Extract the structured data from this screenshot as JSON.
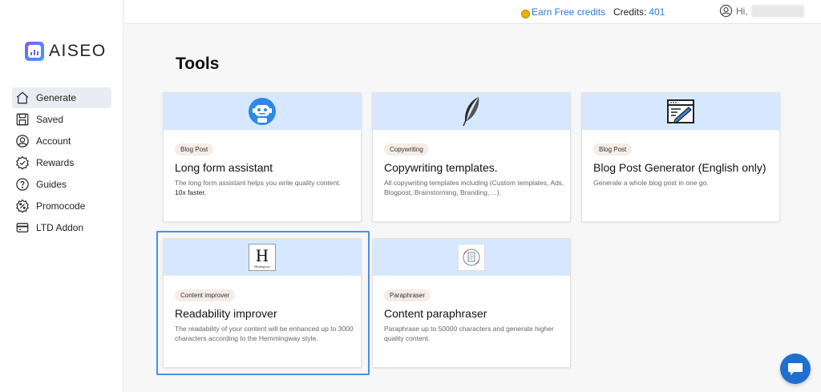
{
  "brand": {
    "name": "AISEO"
  },
  "sidebar": {
    "items": [
      {
        "label": "Generate",
        "icon": "home-icon",
        "active": true
      },
      {
        "label": "Saved",
        "icon": "save-icon"
      },
      {
        "label": "Account",
        "icon": "user-icon"
      },
      {
        "label": "Rewards",
        "icon": "badge-check-icon"
      },
      {
        "label": "Guides",
        "icon": "question-icon"
      },
      {
        "label": "Promocode",
        "icon": "discount-icon"
      },
      {
        "label": "LTD Addon",
        "icon": "card-icon"
      }
    ]
  },
  "topbar": {
    "earn_label": "Earn Free credits",
    "credits_label": "Credits:",
    "credits_value": "401",
    "greeting": "Hi,"
  },
  "main": {
    "title": "Tools",
    "cards": [
      {
        "tag": "Blog Post",
        "title": "Long form assistant",
        "desc": "The long form assistant helps you write quality content.",
        "desc_extra": "10x faster.",
        "icon": "robot-icon"
      },
      {
        "tag": "Copywriting",
        "title": "Copywriting templates.",
        "desc": "All copywriting templates including (Custom templates, Ads, Blogpost, Brainstorming, Branding, ...).",
        "icon": "feather-icon"
      },
      {
        "tag": "Blog Post",
        "title": "Blog Post Generator (English only)",
        "desc": "Generate a whole blog post in one go.",
        "icon": "edit-window-icon"
      },
      {
        "tag": "Content improver",
        "title": "Readability improver",
        "desc": "The readability of your content will be enhanced up to 3000 characters according to the Hemmingway style.",
        "icon": "hemingway-icon",
        "icon_text": "H",
        "icon_subtext": "Hemingway"
      },
      {
        "tag": "Paraphraser",
        "title": "Content paraphraser",
        "desc": "Paraphrase up to 50000 characters and generate higher quality content.",
        "icon": "paraphrase-icon"
      }
    ]
  },
  "colors": {
    "accent": "#2b7bd6",
    "banner": "#d6e8ff",
    "selected": "#4a8cf7",
    "chat": "#1f6fd1"
  }
}
